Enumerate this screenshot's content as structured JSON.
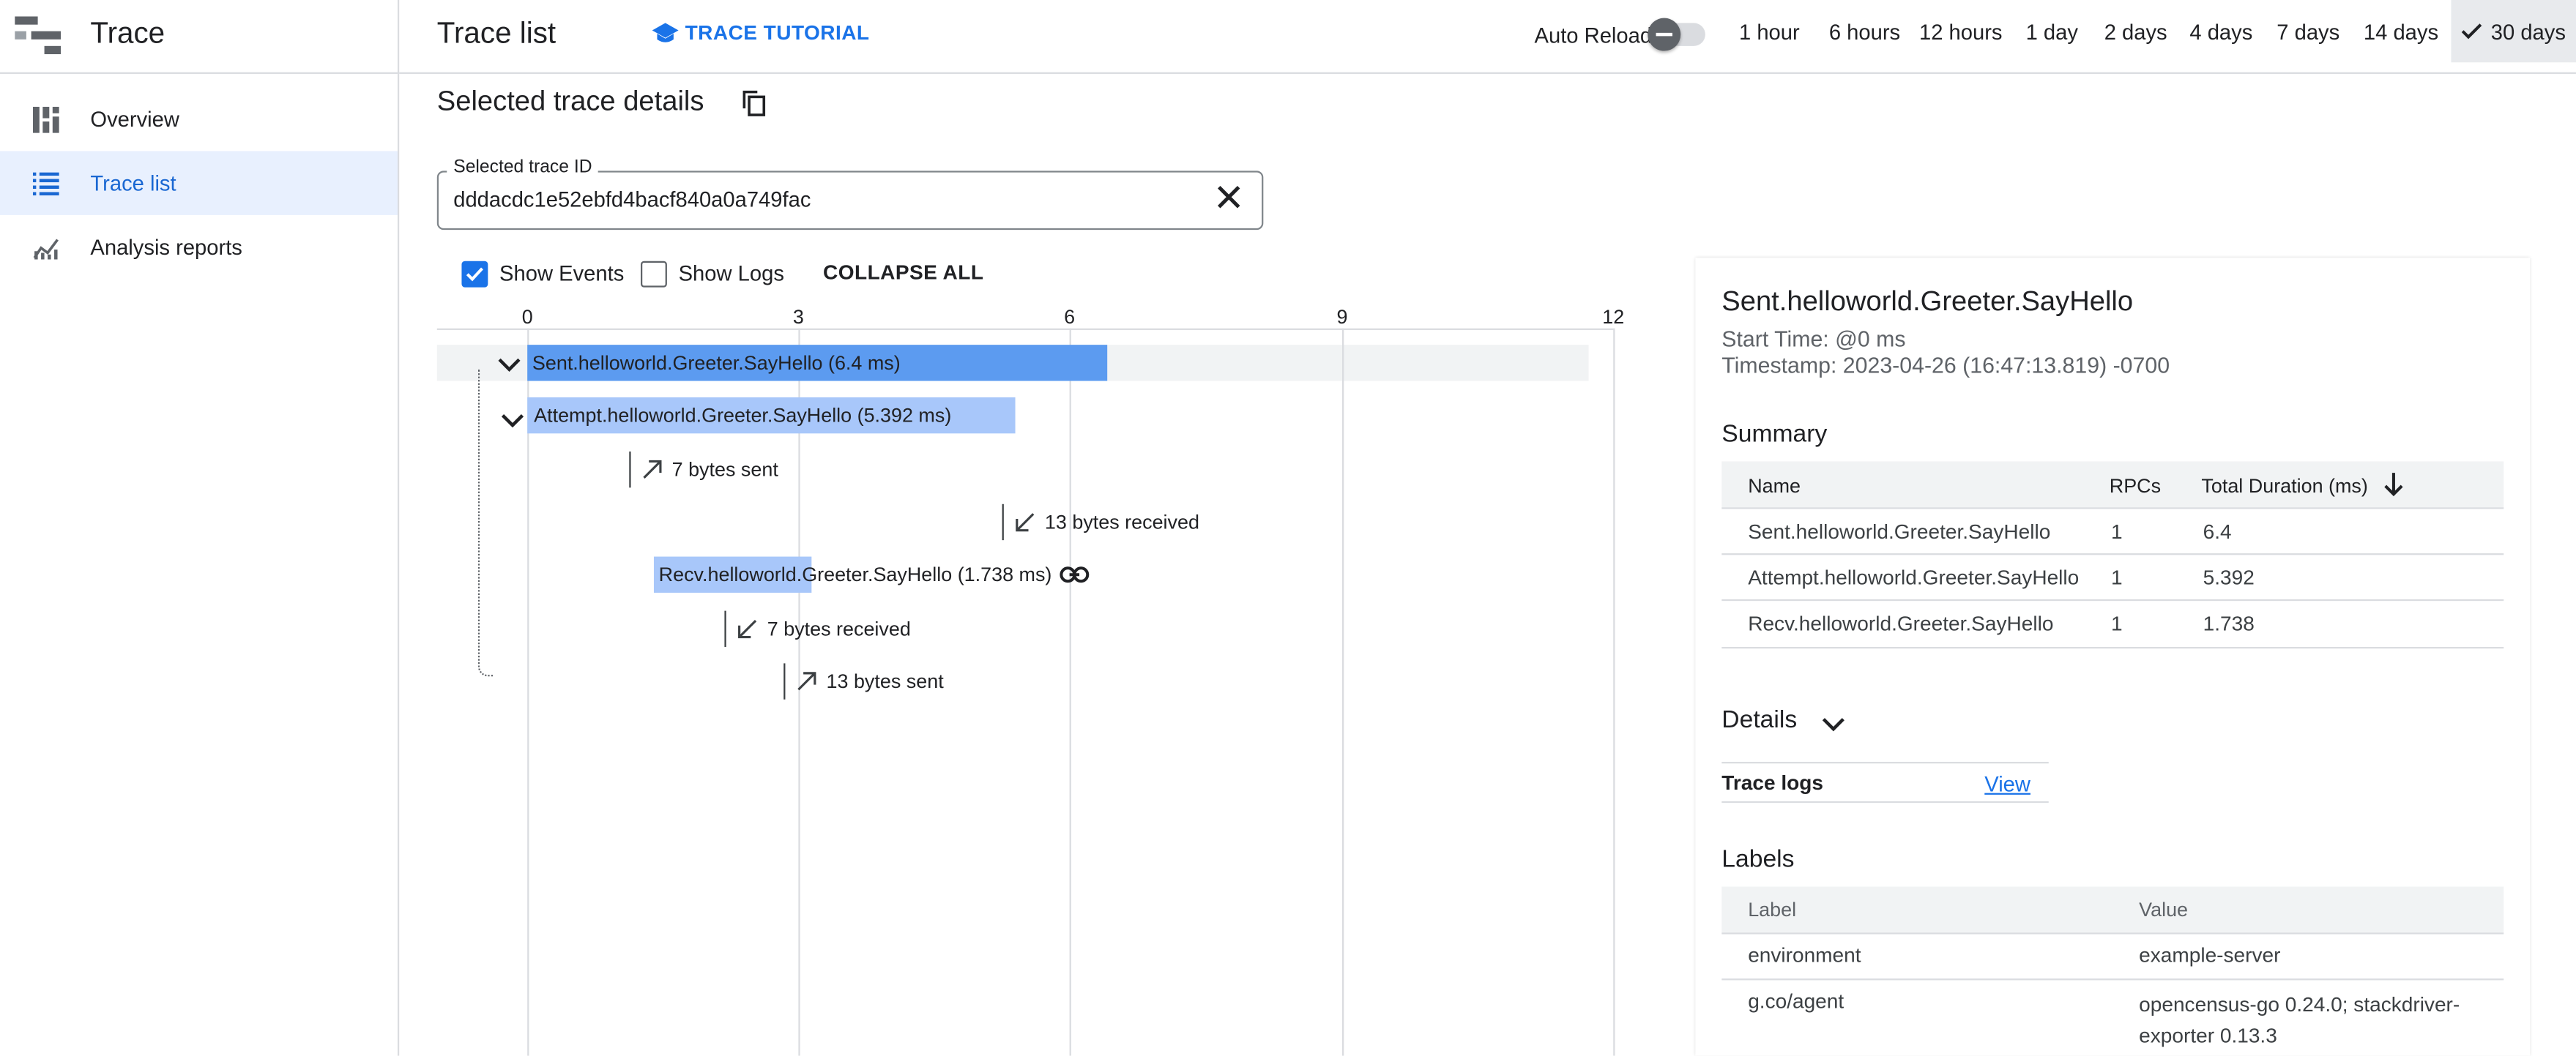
{
  "app": {
    "title": "Trace"
  },
  "sidebar": {
    "items": [
      {
        "label": "Overview",
        "icon": "dashboard-icon"
      },
      {
        "label": "Trace list",
        "icon": "list-icon",
        "active": true
      },
      {
        "label": "Analysis reports",
        "icon": "analytics-icon"
      }
    ]
  },
  "header": {
    "page_title": "Trace list",
    "tutorial_label": "TRACE TUTORIAL",
    "auto_reload_label": "Auto Reload",
    "auto_reload_on": false,
    "ranges": [
      "1 hour",
      "6 hours",
      "12 hours",
      "1 day",
      "2 days",
      "4 days",
      "7 days",
      "14 days",
      "30 days"
    ],
    "selected_range": "30 days"
  },
  "details": {
    "title": "Selected trace details",
    "trace_id_label": "Selected trace ID",
    "trace_id": "dddacdc1e52ebfd4bacf840a0a749fac",
    "show_events_label": "Show Events",
    "show_events_checked": true,
    "show_logs_label": "Show Logs",
    "show_logs_checked": false,
    "collapse_all_label": "COLLAPSE ALL"
  },
  "timeline": {
    "ticks": [
      "0",
      "3",
      "6",
      "9",
      "12"
    ],
    "spans": [
      {
        "label": "Sent.helloworld.Greeter.SayHello (6.4 ms)",
        "start": 0,
        "duration": 6.4,
        "color": "#5c9bf0"
      },
      {
        "label": "Attempt.helloworld.Greeter.SayHello (5.392 ms)",
        "start": 0,
        "duration": 5.392,
        "color": "#a8c7fa"
      },
      {
        "label": "Recv.helloworld.Greeter.SayHello (1.738 ms)",
        "start": 1.4,
        "duration": 1.738,
        "color": "#a8c7fa"
      }
    ],
    "events": [
      {
        "label": "7 bytes sent",
        "direction": "sent"
      },
      {
        "label": "13 bytes received",
        "direction": "received"
      },
      {
        "label": "7 bytes received",
        "direction": "received"
      },
      {
        "label": "13 bytes sent",
        "direction": "sent"
      }
    ]
  },
  "panel": {
    "span_name": "Sent.helloworld.Greeter.SayHello",
    "start_time": "Start Time: @0 ms",
    "timestamp": "Timestamp: 2023-04-26 (16:47:13.819) -0700",
    "summary_title": "Summary",
    "summary_columns": [
      "Name",
      "RPCs",
      "Total Duration (ms)"
    ],
    "summary_rows": [
      [
        "Sent.helloworld.Greeter.SayHello",
        "1",
        "6.4"
      ],
      [
        "Attempt.helloworld.Greeter.SayHello",
        "1",
        "5.392"
      ],
      [
        "Recv.helloworld.Greeter.SayHello",
        "1",
        "1.738"
      ]
    ],
    "details_title": "Details",
    "trace_logs_label": "Trace logs",
    "trace_logs_link": "View",
    "labels_title": "Labels",
    "labels_columns": [
      "Label",
      "Value"
    ],
    "labels_rows": [
      [
        "environment",
        "example-server"
      ],
      [
        "g.co/agent",
        "opencensus-go 0.24.0; stackdriver-exporter 0.13.3"
      ]
    ]
  }
}
